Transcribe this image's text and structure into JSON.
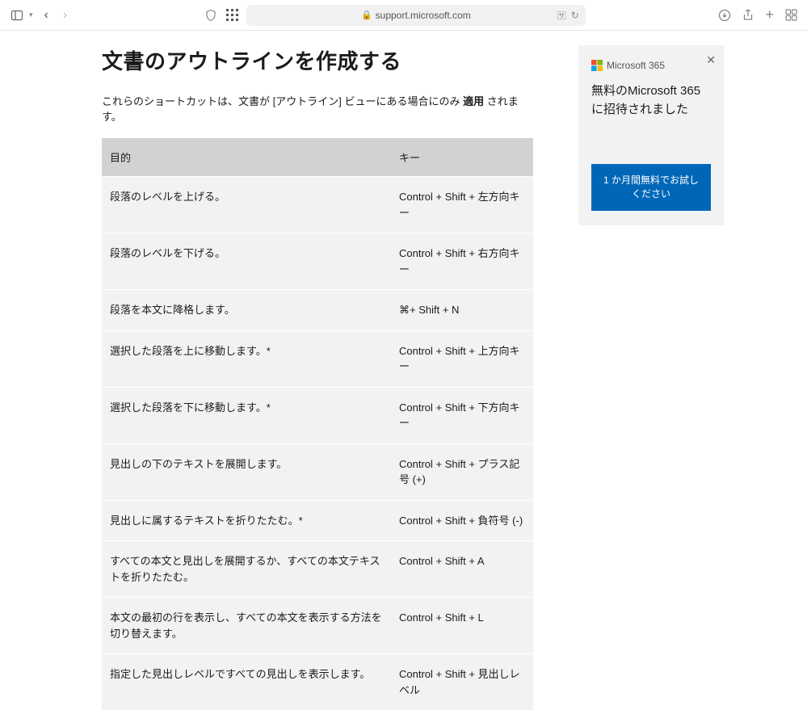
{
  "toolbar": {
    "url": "support.microsoft.com"
  },
  "page": {
    "title": "文書のアウトラインを作成する",
    "intro_pre": "これらのショートカットは、文書が [アウトライン] ビューにある場合にのみ ",
    "intro_bold": "適用",
    "intro_post": " されます。"
  },
  "table": {
    "header_purpose": "目的",
    "header_key": "キー",
    "rows": [
      {
        "purpose": "段落のレベルを上げる。",
        "key": "Control + Shift + 左方向キー"
      },
      {
        "purpose": "段落のレベルを下げる。",
        "key": "Control + Shift + 右方向キー"
      },
      {
        "purpose": "段落を本文に降格します。",
        "key": "⌘+ Shift + N"
      },
      {
        "purpose": "選択した段落を上に移動します。*",
        "key": "Control + Shift + 上方向キー"
      },
      {
        "purpose": "選択した段落を下に移動します。*",
        "key": "Control + Shift + 下方向キー"
      },
      {
        "purpose": "見出しの下のテキストを展開します。",
        "key": "Control + Shift + プラス記号 (+)"
      },
      {
        "purpose": "見出しに属するテキストを折りたたむ。*",
        "key": "Control + Shift + 負符号 (-)"
      },
      {
        "purpose": "すべての本文と見出しを展開するか、すべての本文テキストを折りたたむ。",
        "key": "Control + Shift + A"
      },
      {
        "purpose": "本文の最初の行を表示し、すべての本文を表示する方法を切り替えます。",
        "key": "Control + Shift + L"
      },
      {
        "purpose": "指定した見出しレベルですべての見出しを表示します。",
        "key": "Control + Shift + 見出しレベル"
      }
    ]
  },
  "promo": {
    "logo_text": "Microsoft 365",
    "title": "無料のMicrosoft 365に招待されました",
    "button": "1 か月間無料でお試しください"
  }
}
